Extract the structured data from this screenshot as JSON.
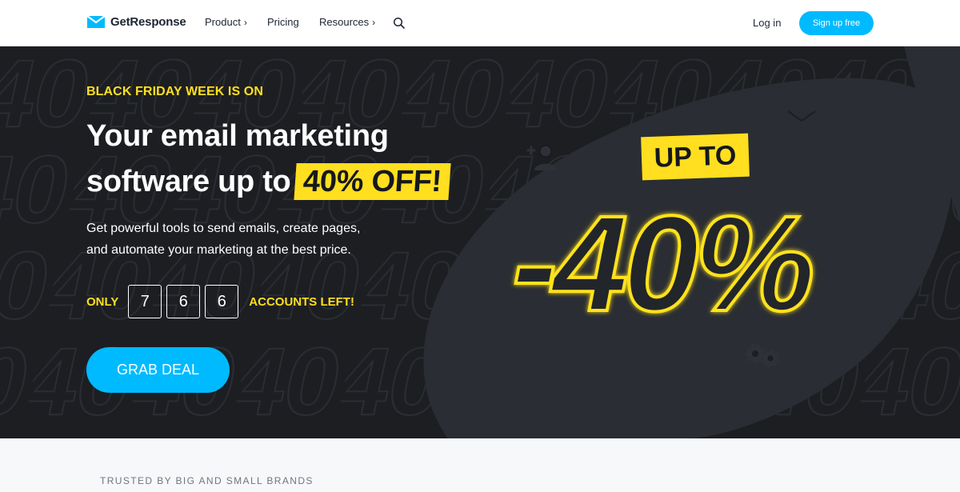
{
  "nav": {
    "brand": "GetResponse",
    "links": [
      {
        "label": "Product",
        "has_chevron": true
      },
      {
        "label": "Pricing",
        "has_chevron": false
      },
      {
        "label": "Resources",
        "has_chevron": true
      }
    ],
    "chevron": "›",
    "search_icon": "search-icon",
    "login_label": "Log in",
    "signup_label": "Sign up free"
  },
  "hero": {
    "eyebrow": "BLACK FRIDAY WEEK IS ON",
    "headline_line1": "Your email marketing",
    "headline_line2": "software up to",
    "headline_highlight": "40% OFF!",
    "subtext_line1": "Get powerful tools to send emails, create pages,",
    "subtext_line2": "and automate your marketing at the best price.",
    "counter_prefix": "ONLY",
    "counter_digits": [
      "7",
      "6",
      "6"
    ],
    "counter_suffix": "ACCOUNTS LEFT!",
    "cta_label": "GRAB DEAL",
    "promo_tag": "UP TO",
    "promo_value": "-40%",
    "icons": [
      "add-user-icon",
      "envelope-icon",
      "gears-icon"
    ]
  },
  "trusted": {
    "label": "TRUSTED BY BIG AND SMALL BRANDS"
  },
  "colors": {
    "accent_blue": "#00baff",
    "accent_yellow": "#ffdf1f",
    "hero_bg": "#1c1e22",
    "text_dark": "#1d2533"
  }
}
